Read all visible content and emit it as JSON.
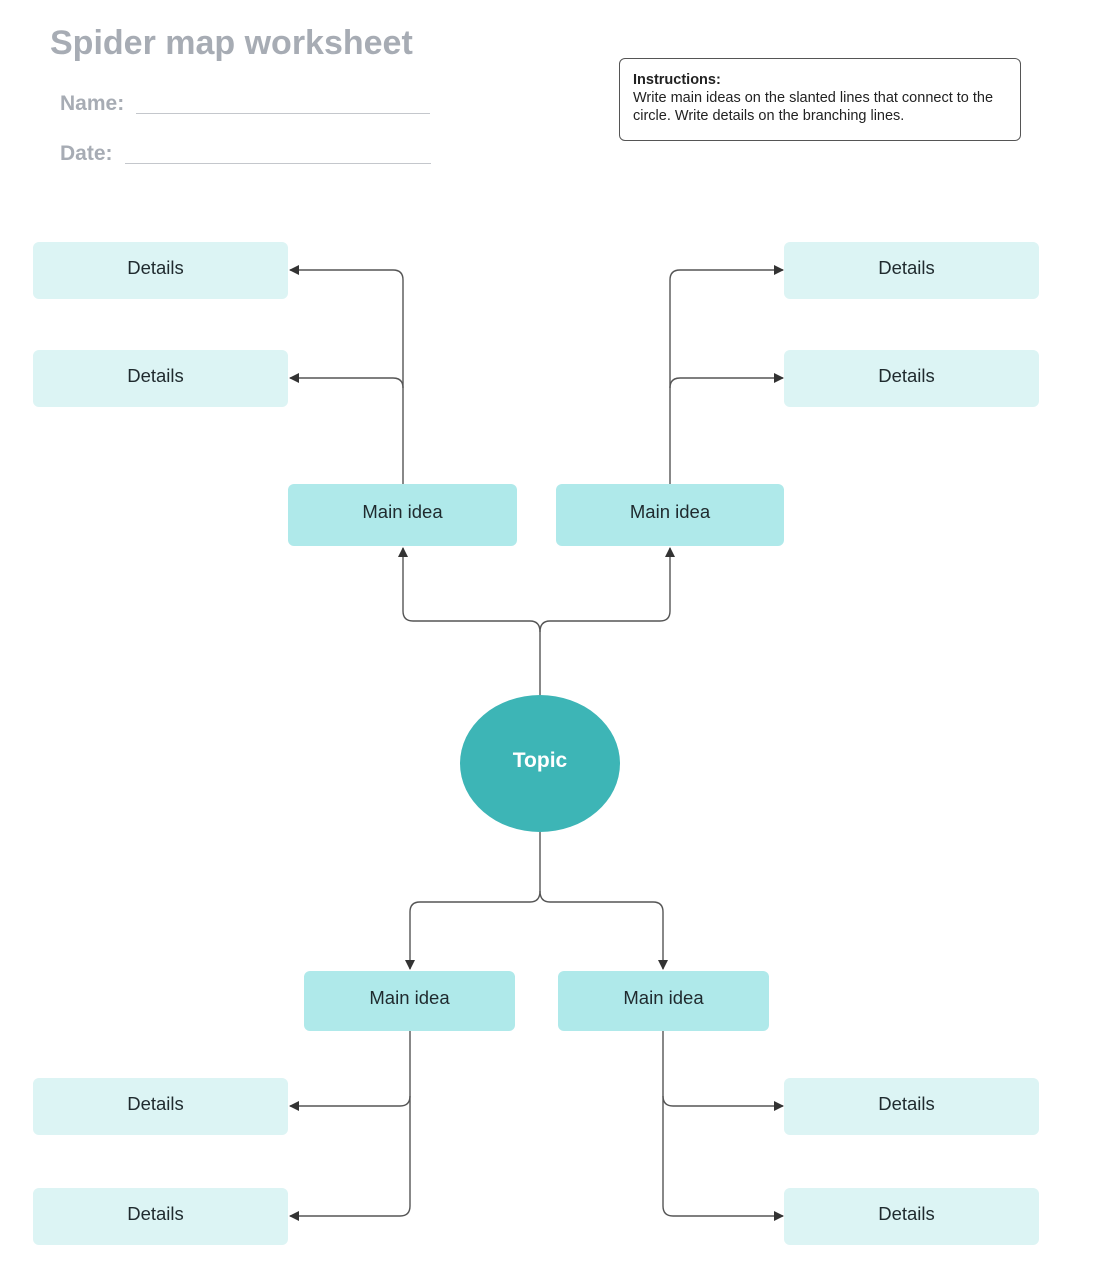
{
  "worksheet": {
    "title": "Spider map worksheet",
    "name_label": "Name:",
    "date_label": "Date:"
  },
  "instructions": {
    "heading": "Instructions:",
    "body": "Write main ideas on the slanted lines that connect to the circle.  Write details on the branching lines."
  },
  "topic": {
    "label": "Topic"
  },
  "branches": [
    {
      "main_idea": "Main idea",
      "details": [
        "Details",
        "Details"
      ]
    },
    {
      "main_idea": "Main idea",
      "details": [
        "Details",
        "Details"
      ]
    },
    {
      "main_idea": "Main idea",
      "details": [
        "Details",
        "Details"
      ]
    },
    {
      "main_idea": "Main idea",
      "details": [
        "Details",
        "Details"
      ]
    }
  ],
  "colors": {
    "topic": "#3db5b6",
    "main_idea": "#afe9ea",
    "details": "#dcf4f4",
    "header_text": "#a7acb4",
    "connector": "#555555"
  }
}
